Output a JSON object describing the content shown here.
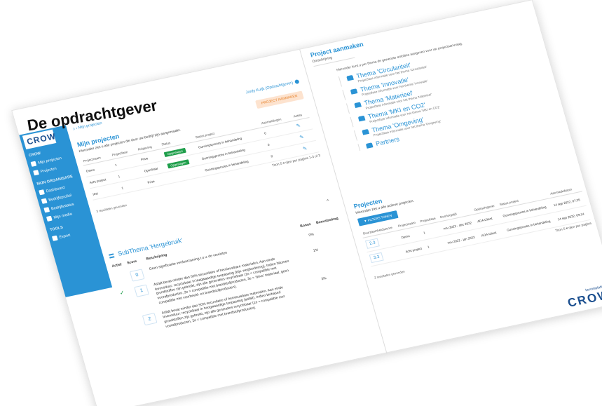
{
  "header": {
    "title": "De opdrachtgever"
  },
  "sidebar": {
    "logo": "CROW",
    "items": [
      {
        "label": "CROW",
        "section": true
      },
      {
        "label": "Mijn projecten"
      },
      {
        "label": "Projecten"
      },
      {
        "label": "MIJN ORGANISATIE",
        "section": true
      },
      {
        "label": "Dashboard"
      },
      {
        "label": "Bedrijfsprofiel"
      },
      {
        "label": "Bedrijfsstatus"
      },
      {
        "label": "Mijn media"
      },
      {
        "label": "TOOLS",
        "section": true
      },
      {
        "label": "Export"
      }
    ]
  },
  "topbar": {
    "breadcrumb": "Mijn projecten",
    "user": "Jordy Kuijk (Opdrachtgever)"
  },
  "projects": {
    "title": "Mijn projecten",
    "subtitle": "Hieronder ziet u alle projecten die door uw bedrijf zijn aangemaakt.",
    "new_button": "PROJECT AANMAKEN",
    "columns": [
      "Projectnaam",
      "Projectfase",
      "Rolgeving",
      "Status",
      "Status project",
      "Aanmeldingen",
      "Acties"
    ],
    "rows": [
      [
        "Demo",
        "1",
        "Prive",
        "Opgeslagen",
        "Gunningsproces in behandeling",
        "0"
      ],
      [
        "Acht project",
        "1",
        "Openbaar",
        "Opgeslagen",
        "Gunningsproces in behandeling",
        "0"
      ],
      [
        "test",
        "1",
        "Prive",
        "",
        "Gunningsproces in behandeling",
        "0"
      ]
    ],
    "pager": "Toon 5 ▾ rijen per pagina  1-3 of 3",
    "footer": "3 resultaten gevonden"
  },
  "subthema": {
    "title": "SubThema 'Hergebruik'",
    "head": {
      "actief": "Actief",
      "score": "Score",
      "desc": "Beschrijving",
      "bonus": "Bonus",
      "bonus2": "Bonusbedrag"
    },
    "rows": [
      {
        "score": "0",
        "desc": "Geen significante verduurzaming t.o.v. de vereisten",
        "bonus": "0%"
      },
      {
        "score": "1",
        "desc": "Asfalt bevat minder dan 50% secundaire of hernieuwbare materialen. Aan einde levensduur: recyclebaar in laagwaardige toepassing (bijv. wegfundering). Indien bitumen grondstoffen zijn gebruikt, zijn alle generaties recyclebaar (1e = compatible met voorafproducten, 2e = compatible met brandstofproducten, 3e = 'drive' materiaal, geen compatible met voorbeeld- en brandstofproducten).",
        "bonus": "1%"
      },
      {
        "score": "2",
        "desc": "Asfalt bevat minder dan 50% secundaire of hernieuwbare materialen. Aan einde levensduur: recyclebaar in hoogwaardige toepassing (asfalt). Indien biobased grondstoffen zijn gebruikt, zijn alle generaties recyclebaar (1e = compatible met voorafproducten, 2e = compatible met brandstofproducten).",
        "bonus": "3%"
      }
    ]
  },
  "aanmaken": {
    "title": "Project aanmaken",
    "tab": "Omschrijving",
    "intro": "Hieronder kunt u per thema de gewenste ambities aangeven voor uw projectaanvraag.",
    "themes": [
      {
        "title": "Thema 'Circulariteit'",
        "desc": "Projectfase informatie voor het thema 'Circulariteit'"
      },
      {
        "title": "Thema 'Innovatie'",
        "desc": "Projectfase informatie voor het thema 'Innovatie'"
      },
      {
        "title": "Thema 'Materieel'",
        "desc": "Projectfase informatie voor het thema 'Materieel'"
      },
      {
        "title": "Thema 'MKI en CO2'",
        "desc": "Projectfase informatie voor het thema 'MKI en CO2'"
      },
      {
        "title": "Thema 'Omgeving'",
        "desc": "Projectfase informatie voor het thema 'Omgeving'"
      },
      {
        "title": "Partners",
        "desc": ""
      }
    ]
  },
  "projecten_right": {
    "title": "Projecten",
    "subtitle": "Hieronder ziet u alle actieve projecten.",
    "filter_button": "FILTERS TONEN",
    "columns": [
      "Duurzaamheidsscore",
      "Projectnaam",
      "Projectfase",
      "Doorlooptijd",
      "Opdrachtgever",
      "Status project",
      "Aanmaakdatum"
    ],
    "rows": [
      [
        "2.3",
        "Demo",
        "1",
        "nov 2022 - dec 2022",
        "ADA Client",
        "Gunningsproces in behandeling",
        "14 sep 2022, 07:25"
      ],
      [
        "3.3",
        "Acht project",
        "1",
        "nov 2022 - jan 2023",
        "ADA Client",
        "Gunningsproces in behandeling",
        "14 sep 2022, 09:14"
      ]
    ],
    "pager": "Toon 5 ▾ rijen per pagina",
    "footer": "2 resultaten gevonden"
  },
  "brand": {
    "kennis": "kennisplatform",
    "logo": "CROW"
  }
}
